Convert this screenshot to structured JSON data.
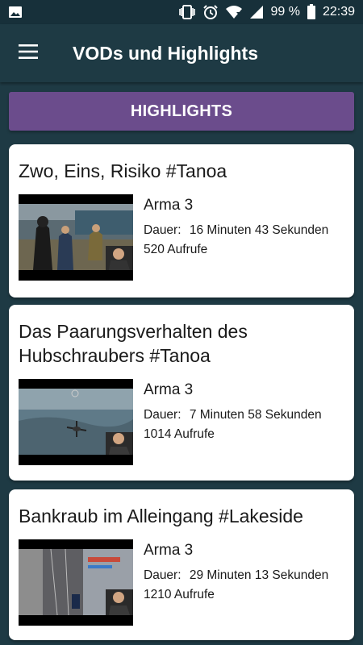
{
  "status_bar": {
    "battery": "99 %",
    "time": "22:39",
    "icons": [
      "image-icon",
      "vibrate-icon",
      "alarm-icon",
      "wifi-icon",
      "signal-icon",
      "battery-icon"
    ]
  },
  "app_bar": {
    "title": "VODs und Highlights",
    "menu_icon": "hamburger-menu-icon"
  },
  "section": {
    "label": "HIGHLIGHTS"
  },
  "videos": [
    {
      "title": "Zwo, Eins, Risiko #Tanoa",
      "game": "Arma 3",
      "duration_label": "Dauer:",
      "duration": "16 Minuten 43 Sekunden",
      "views": "520 Aufrufe"
    },
    {
      "title": "Das Paarungsverhalten des Hubschraubers #Tanoa",
      "game": "Arma 3",
      "duration_label": "Dauer:",
      "duration": "7 Minuten 58 Sekunden",
      "views": "1014 Aufrufe"
    },
    {
      "title": "Bankraub im Alleingang #Lakeside",
      "game": "Arma 3",
      "duration_label": "Dauer:",
      "duration": "29 Minuten 13 Sekunden",
      "views": "1210 Aufrufe"
    }
  ],
  "colors": {
    "background": "#1e3a44",
    "status_bar": "#17303a",
    "accent": "#6b4c8c",
    "card": "#ffffff"
  }
}
